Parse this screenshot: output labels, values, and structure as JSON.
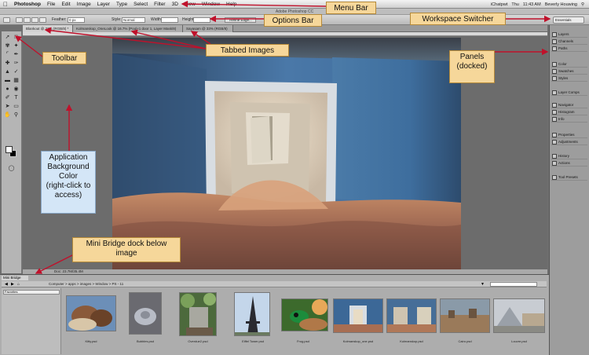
{
  "app": {
    "name": "Photoshop",
    "window_title": "Adobe Photoshop CC"
  },
  "menu": {
    "items": [
      "File",
      "Edit",
      "Image",
      "Layer",
      "Type",
      "Select",
      "Filter",
      "3D",
      "View",
      "Window",
      "Help"
    ]
  },
  "status": {
    "app_name": "iChatpwt",
    "day": "Thu",
    "time": "11:43 AM",
    "user": "Beverly Houwing"
  },
  "options": {
    "feather_label": "Feather:",
    "feather_value": "0 px",
    "style_label": "Style:",
    "style_value": "Normal",
    "width_label": "Width:",
    "height_label": "Height:",
    "refine_label": "Refine Edge..."
  },
  "workspace": {
    "value": "Essentials"
  },
  "tabs": [
    {
      "label": "Blankout @ 33% (RGB/8) *",
      "active": true
    },
    {
      "label": "Kolmanskop_OneLook @ 16.7% (Pool+1 door 1, Layer Mask/8)",
      "active": false
    },
    {
      "label": "Sayasam @ 33% (RGB/8)",
      "active": false
    }
  ],
  "doc_status": "Doc: 23.7M/35.4M",
  "panels": [
    "Layers",
    "Channels",
    "Paths",
    "Color",
    "Swatches",
    "Styles",
    "Layer Comps",
    "Navigator",
    "Histogram",
    "Info",
    "Properties",
    "Adjustments",
    "History",
    "Actions",
    "Tool Presets"
  ],
  "mini_bridge": {
    "tab_label": "Mini Bridge",
    "path": "Computer > apps > images > Window > PS - 11",
    "folder_select": "Favorites",
    "thumbnails": [
      {
        "caption": "Kitty.psd"
      },
      {
        "caption": "Bubbles.psd"
      },
      {
        "caption": "Overdue2.psd"
      },
      {
        "caption": "Eiffel Tower.psd"
      },
      {
        "caption": "Frog.psd"
      },
      {
        "caption": "Kolmanskop_one.psd"
      },
      {
        "caption": "Kolmanskop.psd"
      },
      {
        "caption": "Cairo.psd"
      },
      {
        "caption": "Louvre.psd"
      }
    ]
  },
  "callouts": {
    "menu_bar": "Menu Bar",
    "options_bar": "Options Bar",
    "workspace_switcher": "Workspace Switcher",
    "toolbar": "Toolbar",
    "tabbed_images": "Tabbed Images",
    "panels_line1": "Panels",
    "panels_line2": "(docked)",
    "app_bg_line1": "Application",
    "app_bg_line2": "Background",
    "app_bg_line3": "Color",
    "app_bg_line4": "(right-click to",
    "app_bg_line5": "access)",
    "mini_bridge_line1": "Mini Bridge dock below",
    "mini_bridge_line2": "image"
  },
  "colors": {
    "callout_fill": "#f6d79a",
    "callout_blue": "#d4e6f7",
    "arrow": "#c0112b",
    "app_background": "#6c6c6c"
  }
}
